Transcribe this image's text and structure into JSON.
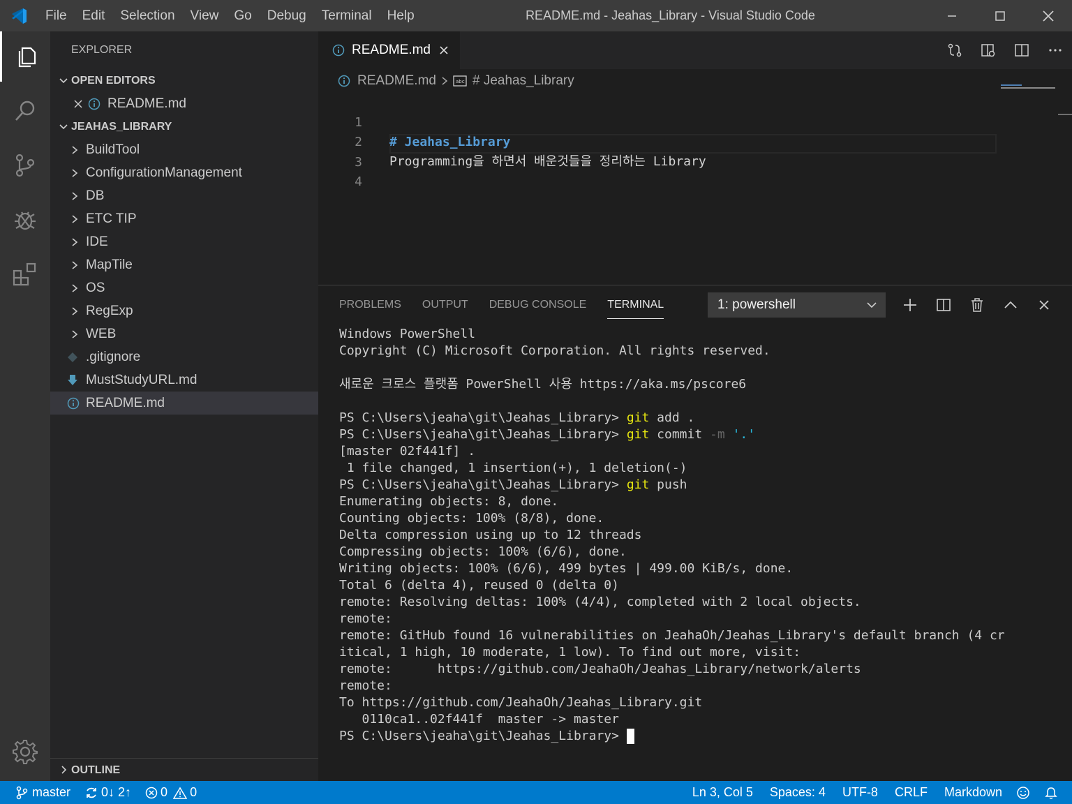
{
  "titlebar": {
    "menus": [
      "File",
      "Edit",
      "Selection",
      "View",
      "Go",
      "Debug",
      "Terminal",
      "Help"
    ],
    "title": "README.md - Jeahas_Library - Visual Studio Code"
  },
  "sidebar": {
    "title": "EXPLORER",
    "open_editors": {
      "header": "OPEN EDITORS",
      "items": [
        {
          "label": "README.md",
          "icon": "info-icon"
        }
      ]
    },
    "workspace": {
      "header": "JEAHAS_LIBRARY",
      "folders": [
        "BuildTool",
        "ConfigurationManagement",
        "DB",
        "ETC TIP",
        "IDE",
        "MapTile",
        "OS",
        "RegExp",
        "WEB"
      ],
      "files": [
        {
          "label": ".gitignore",
          "icon": "git-diamond-icon"
        },
        {
          "label": "MustStudyURL.md",
          "icon": "download-arrow-icon"
        },
        {
          "label": "README.md",
          "icon": "info-icon",
          "selected": true
        }
      ]
    },
    "outline_header": "OUTLINE"
  },
  "editor": {
    "tab_label": "README.md",
    "breadcrumb": {
      "file": "README.md",
      "symbol": "# Jeahas_Library"
    },
    "lines": [
      {
        "num": "1",
        "text": "# Jeahas_Library"
      },
      {
        "num": "2",
        "text": "Programming을 하면서 배운것들을 정리하는 Library"
      },
      {
        "num": "3",
        "text": ""
      },
      {
        "num": "4",
        "text": ""
      }
    ]
  },
  "panel": {
    "tabs": [
      "PROBLEMS",
      "OUTPUT",
      "DEBUG CONSOLE",
      "TERMINAL"
    ],
    "active_tab": "TERMINAL",
    "terminal_select": "1: powershell",
    "prompt": "PS C:\\Users\\jeaha\\git\\Jeahas_Library> ",
    "output": {
      "l1": "Windows PowerShell",
      "l2": "Copyright (C) Microsoft Corporation. All rights reserved.",
      "l4": "새로운 크로스 플랫폼 PowerShell 사용 https://aka.ms/pscore6",
      "cmd1_git": "git",
      "cmd1_rest": " add .",
      "cmd2_git": "git",
      "cmd2_mid": " commit ",
      "cmd2_flag": "-m",
      "cmd2_arg": "'.'",
      "l8": "[master 02f441f] .",
      "l9": " 1 file changed, 1 insertion(+), 1 deletion(-)",
      "cmd3_git": "git",
      "cmd3_rest": " push",
      "l11": "Enumerating objects: 8, done.",
      "l12": "Counting objects: 100% (8/8), done.",
      "l13": "Delta compression using up to 12 threads",
      "l14": "Compressing objects: 100% (6/6), done.",
      "l15": "Writing objects: 100% (6/6), 499 bytes | 499.00 KiB/s, done.",
      "l16": "Total 6 (delta 4), reused 0 (delta 0)",
      "l17": "remote: Resolving deltas: 100% (4/4), completed with 2 local objects.",
      "l18": "remote:",
      "l19": "remote: GitHub found 16 vulnerabilities on JeahaOh/Jeahas_Library's default branch (4 cr",
      "l20": "itical, 1 high, 10 moderate, 1 low). To find out more, visit:",
      "l21": "remote:      https://github.com/JeahaOh/Jeahas_Library/network/alerts",
      "l22": "remote:",
      "l23": "To https://github.com/JeahaOh/Jeahas_Library.git",
      "l24": "   0110ca1..02f441f  master -> master"
    }
  },
  "statusbar": {
    "branch": "master",
    "sync": "0↓ 2↑",
    "errors": "0",
    "warnings": "0",
    "position": "Ln 3, Col 5",
    "spaces": "Spaces: 4",
    "encoding": "UTF-8",
    "eol": "CRLF",
    "language": "Markdown"
  },
  "colors": {
    "accent": "#007acc",
    "heading": "#569cd6",
    "git_keyword": "#e5e510"
  }
}
